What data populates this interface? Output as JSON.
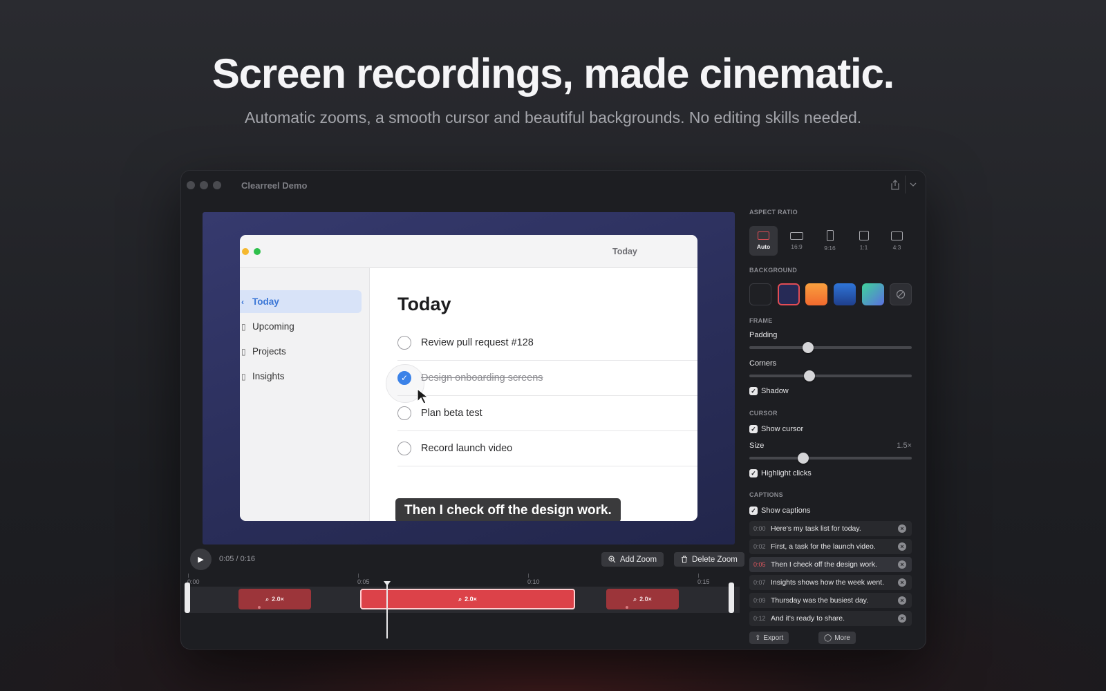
{
  "hero": {
    "title": "Screen recordings, made cinematic.",
    "subtitle": "Automatic zooms, a smooth cursor and beautiful backgrounds. No editing skills needed."
  },
  "window": {
    "title": "Clearreel Demo",
    "share_icon": "share-icon",
    "menu_icon": "chevron-down-icon"
  },
  "preview": {
    "app_title": "Today",
    "sidebar": [
      {
        "label": "Today",
        "active": true
      },
      {
        "label": "Upcoming",
        "active": false
      },
      {
        "label": "Projects",
        "active": false
      },
      {
        "label": "Insights",
        "active": false
      }
    ],
    "heading": "Today",
    "tasks": [
      {
        "label": "Review pull request #128",
        "done": false
      },
      {
        "label": "Design onboarding screens",
        "done": true
      },
      {
        "label": "Plan beta test",
        "done": false
      },
      {
        "label": "Record launch video",
        "done": false
      }
    ],
    "caption": "Then I check off the design work."
  },
  "player": {
    "time": "0:05 / 0:16",
    "add_zoom": "Add Zoom",
    "delete_zoom": "Delete Zoom",
    "ruler": [
      "0:00",
      "0:05",
      "0:10",
      "0:15"
    ],
    "zooms": [
      {
        "label": "2.0×",
        "selected": false
      },
      {
        "label": "2.0×",
        "selected": true
      },
      {
        "label": "2.0×",
        "selected": false
      }
    ]
  },
  "panel": {
    "aspect_ratio": {
      "heading": "ASPECT RATIO",
      "options": [
        {
          "label": "Auto",
          "active": true
        },
        {
          "label": "16:9",
          "active": false
        },
        {
          "label": "9:16",
          "active": false
        },
        {
          "label": "1:1",
          "active": false
        },
        {
          "label": "4:3",
          "active": false
        }
      ]
    },
    "background": {
      "heading": "BACKGROUND",
      "swatches": [
        "#1f2024",
        "#262a56",
        "#f7933a",
        "#2d63c4",
        "#3fb9a0"
      ],
      "selected_index": 1
    },
    "frame": {
      "heading": "FRAME",
      "padding_label": "Padding",
      "padding_value": 0.36,
      "corners_label": "Corners",
      "corners_value": 0.37,
      "shadow_label": "Shadow",
      "shadow_checked": true
    },
    "cursor": {
      "heading": "CURSOR",
      "show_label": "Show cursor",
      "size_label": "Size",
      "size_value": "1.5×",
      "size_level": 0.33,
      "highlight_label": "Highlight clicks"
    },
    "captions": {
      "heading": "CAPTIONS",
      "show_label": "Show captions",
      "items": [
        {
          "time": "0:00",
          "text": "Here's my task list for today.",
          "current": false
        },
        {
          "time": "0:02",
          "text": "First, a task for the launch video.",
          "current": false
        },
        {
          "time": "0:05",
          "text": "Then I check off the design work.",
          "current": true
        },
        {
          "time": "0:07",
          "text": "Insights shows how the week went.",
          "current": false
        },
        {
          "time": "0:09",
          "text": "Thursday was the busiest day.",
          "current": false
        },
        {
          "time": "0:12",
          "text": "And it's ready to share.",
          "current": false
        }
      ]
    },
    "footer": {
      "export": "Export",
      "more": "More"
    },
    "accent": "#e24d55"
  }
}
